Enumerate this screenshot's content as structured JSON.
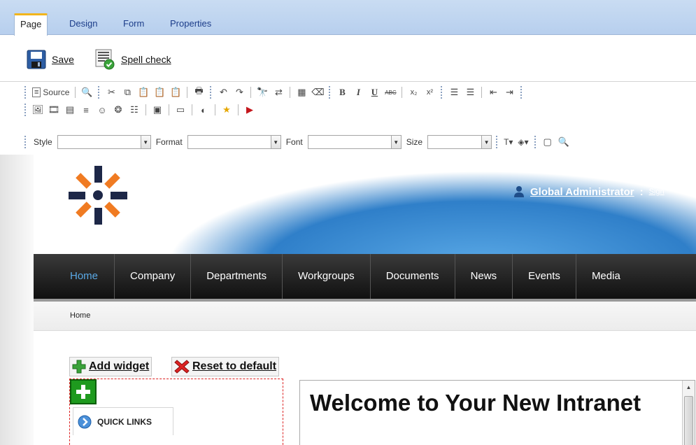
{
  "tabs": [
    {
      "label": "Page",
      "active": true
    },
    {
      "label": "Design",
      "active": false
    },
    {
      "label": "Form",
      "active": false
    },
    {
      "label": "Properties",
      "active": false
    }
  ],
  "actions": {
    "save_label": "Save",
    "spellcheck_label": "Spell check"
  },
  "toolbar": {
    "source_label": "Source",
    "style_label": "Style",
    "format_label": "Format",
    "font_label": "Font",
    "size_label": "Size",
    "style_value": "",
    "format_value": "",
    "font_value": "",
    "size_value": ""
  },
  "site": {
    "user_name": "Global Administrator",
    "user_sep": ":",
    "sign_label": "Sign",
    "nav": [
      "Home",
      "Company",
      "Departments",
      "Workgroups",
      "Documents",
      "News",
      "Events",
      "Media"
    ],
    "nav_active": "Home",
    "breadcrumb": "Home"
  },
  "widgets": {
    "add_label": "Add widget",
    "reset_label": "Reset to default",
    "quick_links_label": "QUICK LINKS"
  },
  "main": {
    "heading": "Welcome to Your New Intranet"
  },
  "colors": {
    "accent": "#f2b51c",
    "nav_active": "#5aa9e6",
    "logo_orange": "#f07b22",
    "logo_navy": "#1d2747"
  }
}
